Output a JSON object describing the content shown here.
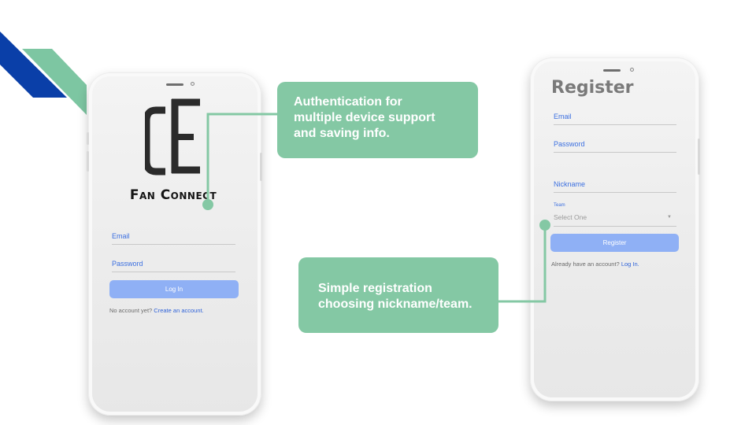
{
  "colors": {
    "accent_green": "#84c8a4",
    "stripe_blue": "#0a3fa8",
    "stripe_green": "#7dc6a2",
    "link_blue": "#2f62d8",
    "button_blue": "#8fb0f5"
  },
  "login_screen": {
    "brand_name": "Fan Connect",
    "email_label": "Email",
    "password_label": "Password",
    "login_button": "Log In",
    "footer_text": "No account yet?",
    "footer_link": "Create an account."
  },
  "register_screen": {
    "title": "Register",
    "email_label": "Email",
    "password_label": "Password",
    "nickname_label": "Nickname",
    "team_label": "Team",
    "team_select_value": "Select One",
    "register_button": "Register",
    "footer_text": "Already have an account?",
    "footer_link": "Log In."
  },
  "callouts": [
    {
      "lines": [
        "Authentication for",
        "multiple device support",
        "and saving info."
      ]
    },
    {
      "lines": [
        "Simple registration",
        "choosing nickname/team."
      ]
    }
  ],
  "icons": {
    "logo": "fan-connect-logo-icon",
    "caret": "chevron-down-icon"
  }
}
